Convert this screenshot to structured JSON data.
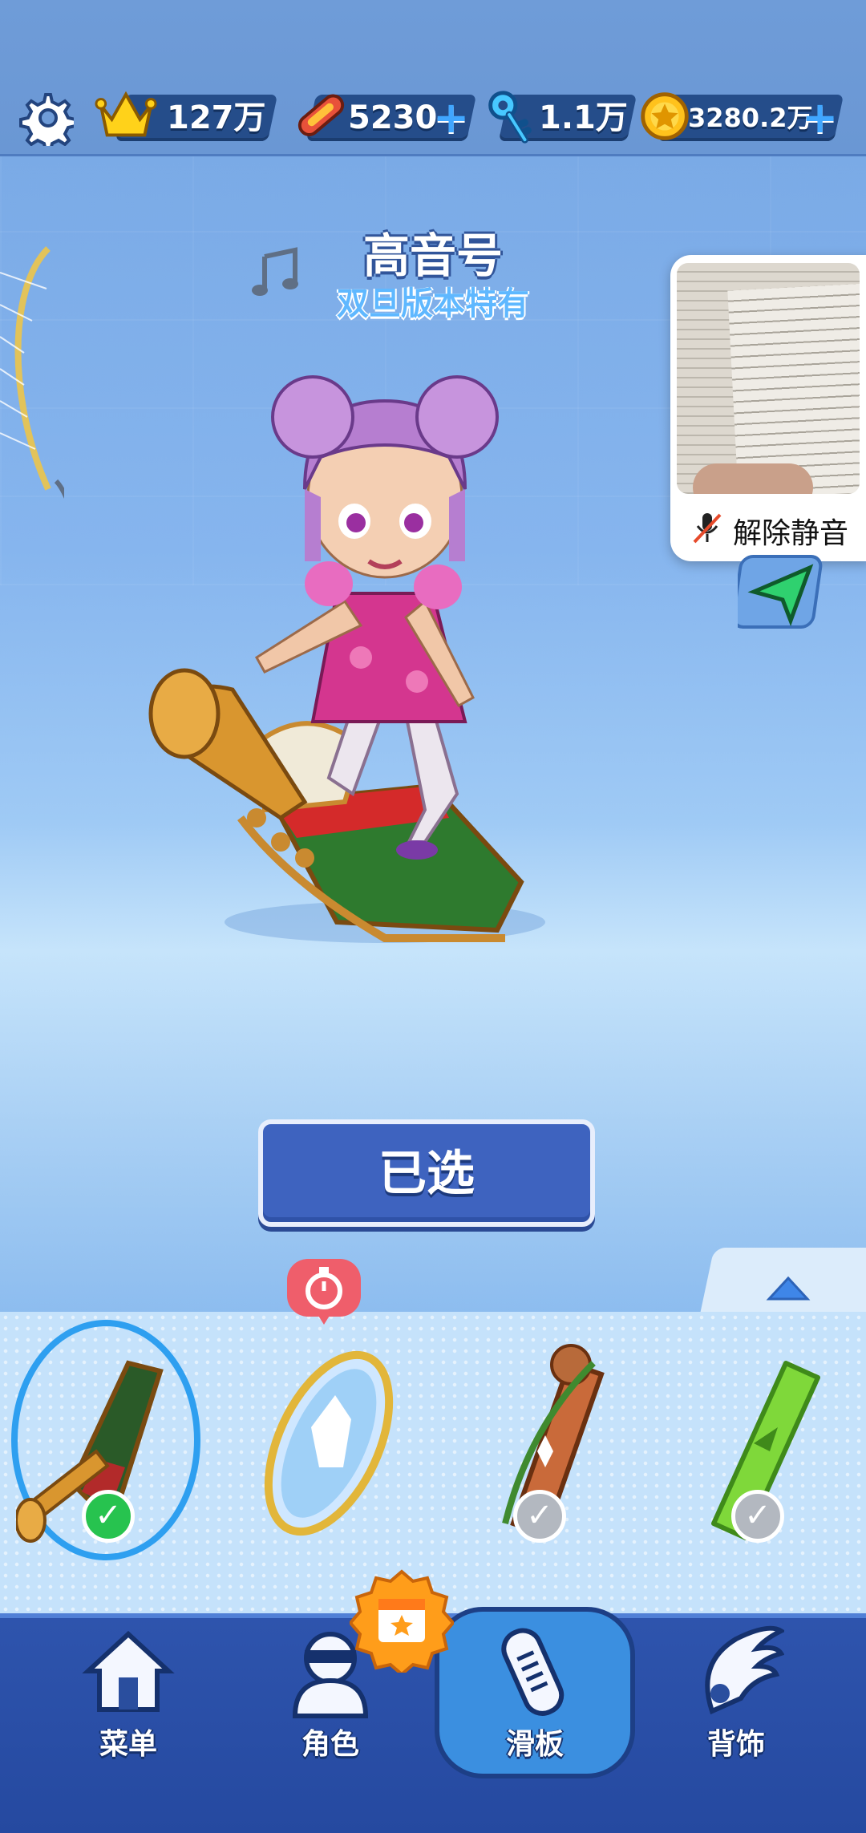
{
  "topbar": {
    "crown_value": "127万",
    "board_value": "5230",
    "key_value": "1.1万",
    "coin_value": "3280.2万"
  },
  "board": {
    "name": "高音号",
    "tag": "双旦版本特有"
  },
  "pip": {
    "unmute_label": "解除静音"
  },
  "select_button": "已选",
  "slots": [
    {
      "name": "trumpet-board",
      "owned": true,
      "selected": true
    },
    {
      "name": "mirror-board",
      "owned": false,
      "selected": false,
      "timed": true
    },
    {
      "name": "reindeer-board",
      "owned": true,
      "selected": false
    },
    {
      "name": "leaf-board",
      "owned": true,
      "selected": false
    }
  ],
  "nav": {
    "menu": "菜单",
    "character": "角色",
    "board": "滑板",
    "back": "背饰",
    "active": "滑板"
  },
  "colors": {
    "accent": "#3e63bf",
    "check_on": "#27c34f",
    "check_off": "#b3b8c0",
    "timer": "#ef5e6b"
  }
}
